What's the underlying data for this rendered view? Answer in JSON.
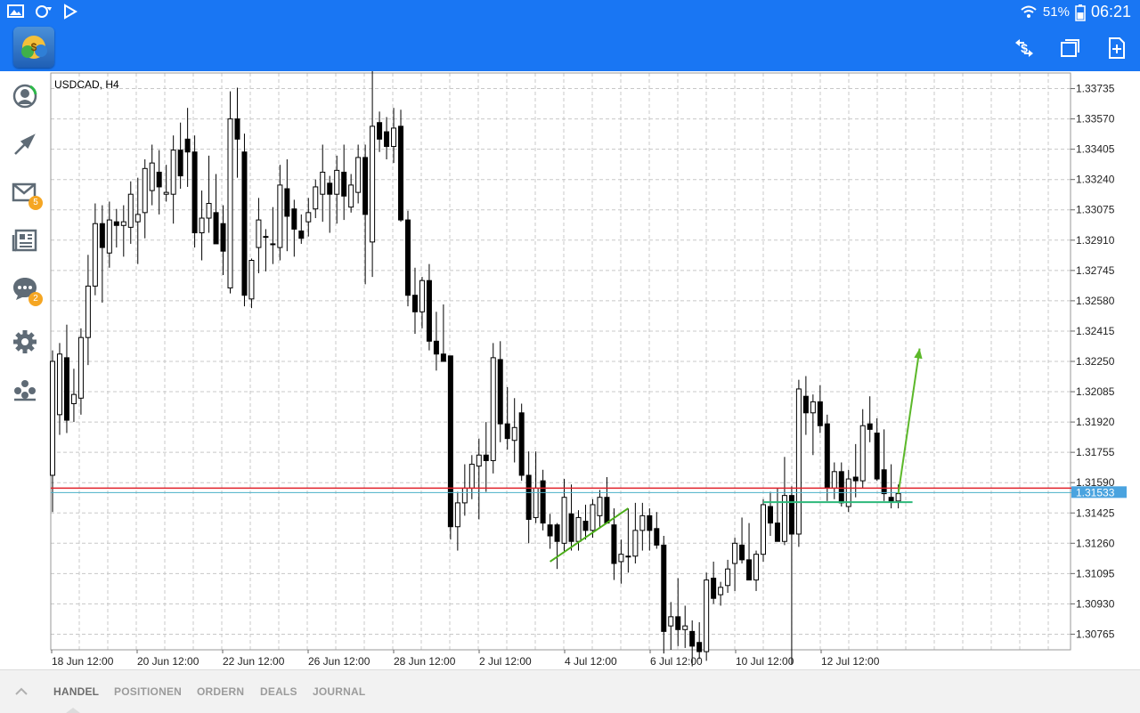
{
  "statusbar": {
    "battery": "51%",
    "time": "06:21"
  },
  "appbar": {
    "logo": "metatrader-logo",
    "actions": [
      "one-click-trading-icon",
      "window-icon",
      "new-order-icon"
    ]
  },
  "sidebar": {
    "items": [
      {
        "icon": "account-icon"
      },
      {
        "icon": "trade-icon"
      },
      {
        "icon": "mail-icon",
        "badge": "5"
      },
      {
        "icon": "news-icon"
      },
      {
        "icon": "chat-icon",
        "badge": "2"
      },
      {
        "icon": "settings-icon"
      },
      {
        "icon": "community-icon"
      }
    ]
  },
  "bottom_tabs": [
    {
      "label": "HANDEL",
      "active": true
    },
    {
      "label": "POSITIONEN"
    },
    {
      "label": "ORDERN"
    },
    {
      "label": "DEALS"
    },
    {
      "label": "JOURNAL"
    }
  ],
  "chart_data": {
    "type": "candlestick",
    "title": "USDCAD, H4",
    "ylim": [
      1.3068,
      1.3382
    ],
    "y_ticks": [
      "1.33735",
      "1.33570",
      "1.33405",
      "1.33240",
      "1.33075",
      "1.32910",
      "1.32745",
      "1.32580",
      "1.32415",
      "1.32250",
      "1.32085",
      "1.31920",
      "1.31755",
      "1.31590",
      "1.31425",
      "1.31260",
      "1.31095",
      "1.30930",
      "1.30765"
    ],
    "x_ticks": [
      "18 Jun 12:00",
      "20 Jun 12:00",
      "22 Jun 12:00",
      "26 Jun 12:00",
      "28 Jun 12:00",
      "2 Jul 12:00",
      "4 Jul 12:00",
      "6 Jul 12:00",
      "10 Jul 12:00",
      "12 Jul 12:00"
    ],
    "bid_line": 1.31536,
    "ask_line": 1.3156,
    "price_label": "1.31533",
    "candles": [
      [
        1.3163,
        1.3231,
        1.3143,
        1.3225
      ],
      [
        1.3196,
        1.3235,
        1.3185,
        1.3229
      ],
      [
        1.3227,
        1.3245,
        1.3186,
        1.3193
      ],
      [
        1.3202,
        1.3221,
        1.3192,
        1.3207
      ],
      [
        1.3205,
        1.3243,
        1.3196,
        1.3238
      ],
      [
        1.3238,
        1.3283,
        1.3223,
        1.3266
      ],
      [
        1.3266,
        1.3311,
        1.3261,
        1.33
      ],
      [
        1.33,
        1.331,
        1.3257,
        1.3287
      ],
      [
        1.3284,
        1.3312,
        1.3276,
        1.3302
      ],
      [
        1.3301,
        1.3308,
        1.3287,
        1.3299
      ],
      [
        1.3299,
        1.331,
        1.3282,
        1.3301
      ],
      [
        1.3298,
        1.3323,
        1.3289,
        1.3316
      ],
      [
        1.3301,
        1.3325,
        1.3278,
        1.3305
      ],
      [
        1.3306,
        1.3335,
        1.3292,
        1.333
      ],
      [
        1.3318,
        1.3343,
        1.331,
        1.3333
      ],
      [
        1.3328,
        1.334,
        1.3305,
        1.332
      ],
      [
        1.3316,
        1.3332,
        1.3312,
        1.3317
      ],
      [
        1.3316,
        1.3348,
        1.33,
        1.334
      ],
      [
        1.334,
        1.3355,
        1.3319,
        1.3326
      ],
      [
        1.3346,
        1.3363,
        1.332,
        1.3339
      ],
      [
        1.3339,
        1.3348,
        1.3287,
        1.3295
      ],
      [
        1.3295,
        1.3318,
        1.328,
        1.3303
      ],
      [
        1.3303,
        1.3337,
        1.3295,
        1.3311
      ],
      [
        1.3306,
        1.3327,
        1.3292,
        1.3289
      ],
      [
        1.33,
        1.331,
        1.3272,
        1.3285
      ],
      [
        1.3265,
        1.3372,
        1.3262,
        1.3357
      ],
      [
        1.3357,
        1.3374,
        1.3325,
        1.3346
      ],
      [
        1.3339,
        1.3349,
        1.3255,
        1.3261
      ],
      [
        1.3259,
        1.3281,
        1.3254,
        1.328
      ],
      [
        1.3287,
        1.3314,
        1.3273,
        1.3302
      ],
      [
        1.3293,
        1.3297,
        1.3274,
        1.3293
      ],
      [
        1.3289,
        1.3309,
        1.3278,
        1.3289
      ],
      [
        1.3287,
        1.3332,
        1.328,
        1.3321
      ],
      [
        1.3319,
        1.3335,
        1.3285,
        1.3304
      ],
      [
        1.3308,
        1.3313,
        1.3282,
        1.3297
      ],
      [
        1.3296,
        1.3305,
        1.3289,
        1.3292
      ],
      [
        1.3301,
        1.3314,
        1.3293,
        1.3306
      ],
      [
        1.3308,
        1.3324,
        1.3303,
        1.332
      ],
      [
        1.3316,
        1.3343,
        1.3301,
        1.3328
      ],
      [
        1.3322,
        1.3326,
        1.3295,
        1.3316
      ],
      [
        1.3316,
        1.3337,
        1.33,
        1.3329
      ],
      [
        1.3328,
        1.3343,
        1.3302,
        1.3315
      ],
      [
        1.3309,
        1.3327,
        1.3306,
        1.3321
      ],
      [
        1.3317,
        1.3343,
        1.3311,
        1.3336
      ],
      [
        1.3336,
        1.3343,
        1.3267,
        1.3305
      ],
      [
        1.329,
        1.3383,
        1.3271,
        1.3353
      ],
      [
        1.3355,
        1.3361,
        1.3339,
        1.3346
      ],
      [
        1.335,
        1.3358,
        1.3335,
        1.3342
      ],
      [
        1.3342,
        1.3363,
        1.3333,
        1.3352
      ],
      [
        1.3353,
        1.3362,
        1.3301,
        1.3302
      ],
      [
        1.3302,
        1.3307,
        1.3255,
        1.3261
      ],
      [
        1.3261,
        1.3276,
        1.324,
        1.3252
      ],
      [
        1.3252,
        1.3271,
        1.3243,
        1.3269
      ],
      [
        1.3269,
        1.3278,
        1.3231,
        1.3236
      ],
      [
        1.3236,
        1.3252,
        1.322,
        1.3229
      ],
      [
        1.3229,
        1.3256,
        1.3225,
        1.3225
      ],
      [
        1.3228,
        1.3228,
        1.3128,
        1.3135
      ],
      [
        1.3135,
        1.3154,
        1.3122,
        1.3148
      ],
      [
        1.3148,
        1.3169,
        1.3141,
        1.3156
      ],
      [
        1.3156,
        1.3174,
        1.315,
        1.3169
      ],
      [
        1.3168,
        1.3183,
        1.3139,
        1.3174
      ],
      [
        1.3174,
        1.3192,
        1.3154,
        1.3171
      ],
      [
        1.3171,
        1.3235,
        1.3164,
        1.3227
      ],
      [
        1.3226,
        1.3236,
        1.3181,
        1.3191
      ],
      [
        1.3191,
        1.3211,
        1.3177,
        1.3183
      ],
      [
        1.3182,
        1.3205,
        1.317,
        1.3189
      ],
      [
        1.3197,
        1.3202,
        1.316,
        1.3163
      ],
      [
        1.3163,
        1.3176,
        1.3126,
        1.3139
      ],
      [
        1.314,
        1.3176,
        1.3137,
        1.3156
      ],
      [
        1.316,
        1.3166,
        1.3133,
        1.3137
      ],
      [
        1.3136,
        1.3142,
        1.3123,
        1.313
      ],
      [
        1.3136,
        1.3137,
        1.3112,
        1.3127
      ],
      [
        1.3126,
        1.3161,
        1.3121,
        1.3151
      ],
      [
        1.3142,
        1.3158,
        1.3122,
        1.3127
      ],
      [
        1.3127,
        1.3144,
        1.3122,
        1.314
      ],
      [
        1.3138,
        1.3147,
        1.3128,
        1.3133
      ],
      [
        1.3133,
        1.315,
        1.3129,
        1.3147
      ],
      [
        1.3141,
        1.3155,
        1.3134,
        1.3151
      ],
      [
        1.3151,
        1.3162,
        1.3143,
        1.3137
      ],
      [
        1.3136,
        1.3145,
        1.3106,
        1.3115
      ],
      [
        1.3116,
        1.3128,
        1.3104,
        1.312
      ],
      [
        1.3119,
        1.3145,
        1.311,
        1.3119
      ],
      [
        1.3119,
        1.3148,
        1.3115,
        1.3133
      ],
      [
        1.3133,
        1.3148,
        1.3122,
        1.3141
      ],
      [
        1.3141,
        1.3145,
        1.3122,
        1.3133
      ],
      [
        1.3134,
        1.3143,
        1.3123,
        1.3125
      ],
      [
        1.3125,
        1.313,
        1.3066,
        1.3078
      ],
      [
        1.3081,
        1.3094,
        1.3068,
        1.3086
      ],
      [
        1.3086,
        1.3107,
        1.307,
        1.3079
      ],
      [
        1.3079,
        1.3092,
        1.3069,
        1.3081
      ],
      [
        1.3078,
        1.3084,
        1.3059,
        1.307
      ],
      [
        1.3072,
        1.3083,
        1.3063,
        1.3067
      ],
      [
        1.3067,
        1.311,
        1.3062,
        1.3106
      ],
      [
        1.3107,
        1.3116,
        1.3093,
        1.3096
      ],
      [
        1.3098,
        1.3105,
        1.3092,
        1.3102
      ],
      [
        1.3103,
        1.3117,
        1.3099,
        1.3112
      ],
      [
        1.3115,
        1.3129,
        1.31,
        1.3126
      ],
      [
        1.3125,
        1.314,
        1.3115,
        1.3117
      ],
      [
        1.3117,
        1.3137,
        1.311,
        1.3106
      ],
      [
        1.3106,
        1.3122,
        1.31,
        1.312
      ],
      [
        1.312,
        1.315,
        1.3116,
        1.3147
      ],
      [
        1.3146,
        1.3154,
        1.313,
        1.3137
      ],
      [
        1.3137,
        1.3156,
        1.3131,
        1.3127
      ],
      [
        1.3127,
        1.3173,
        1.3125,
        1.3152
      ],
      [
        1.3152,
        1.3157,
        1.306,
        1.3131
      ],
      [
        1.3131,
        1.3215,
        1.3124,
        1.321
      ],
      [
        1.3206,
        1.3217,
        1.3185,
        1.3197
      ],
      [
        1.3197,
        1.3207,
        1.3174,
        1.3203
      ],
      [
        1.3203,
        1.3212,
        1.3186,
        1.319
      ],
      [
        1.3191,
        1.3196,
        1.3149,
        1.3156
      ],
      [
        1.3156,
        1.317,
        1.315,
        1.3165
      ],
      [
        1.3165,
        1.317,
        1.3146,
        1.3148
      ],
      [
        1.3146,
        1.3166,
        1.3143,
        1.3161
      ],
      [
        1.3162,
        1.318,
        1.3151,
        1.316
      ],
      [
        1.316,
        1.3199,
        1.3156,
        1.319
      ],
      [
        1.3191,
        1.3206,
        1.3181,
        1.3188
      ],
      [
        1.3186,
        1.3194,
        1.316,
        1.3161
      ],
      [
        1.3166,
        1.3188,
        1.3149,
        1.3153
      ],
      [
        1.3151,
        1.3169,
        1.3145,
        1.3149
      ],
      [
        1.3149,
        1.3158,
        1.3145,
        1.3153
      ]
    ],
    "annotations": [
      {
        "type": "trendline",
        "color": "#4cae1a",
        "from": [
          70,
          1.3116
        ],
        "to": [
          81,
          1.3145
        ]
      },
      {
        "type": "segment",
        "color": "#2db87a",
        "from": [
          100,
          1.31484
        ],
        "to": [
          121,
          1.31484
        ]
      },
      {
        "type": "arrow",
        "color": "#5cb82a",
        "from": [
          119,
          1.3153
        ],
        "to": [
          122,
          1.3232
        ]
      }
    ]
  }
}
